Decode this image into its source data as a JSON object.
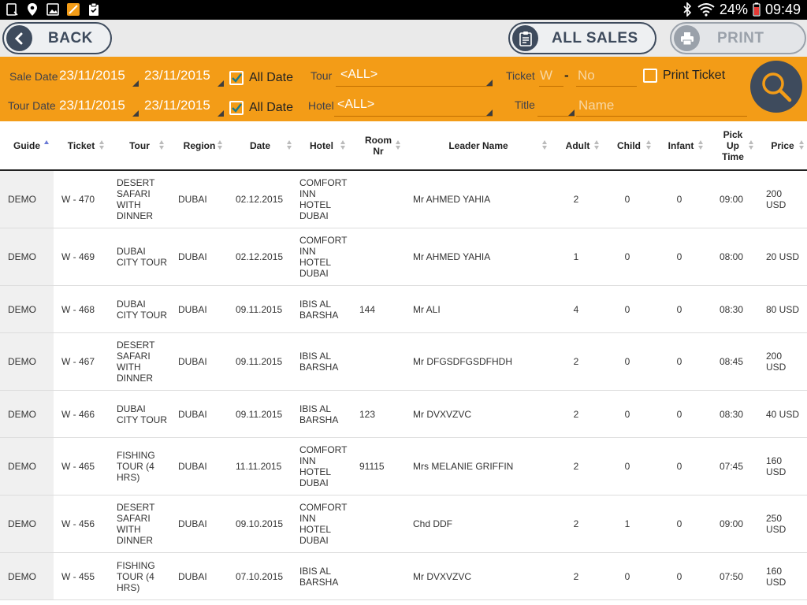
{
  "status_bar": {
    "battery": "24%",
    "time": "09:49"
  },
  "action_bar": {
    "back_label": "BACK",
    "all_sales_label": "ALL SALES",
    "print_label": "PRINT"
  },
  "filters": {
    "sale_date_label": "Sale Date",
    "sale_date_from": "23/11/2015",
    "sale_date_to": "23/11/2015",
    "tour_date_label": "Tour Date",
    "tour_date_from": "23/11/2015",
    "tour_date_to": "23/11/2015",
    "all_date_label": "All Date",
    "tour_label": "Tour",
    "tour_value": "<ALL>",
    "hotel_label": "Hotel",
    "hotel_value": "<ALL>",
    "ticket_label": "Ticket",
    "ticket_prefix": "W",
    "ticket_dash": "-",
    "ticket_no_placeholder": "No",
    "print_ticket_label": "Print Ticket",
    "title_label": "Title",
    "name_placeholder": "Name"
  },
  "table": {
    "columns": [
      "Guide",
      "Ticket",
      "Tour",
      "Region",
      "Date",
      "Hotel",
      "Room Nr",
      "Leader Name",
      "Adult",
      "Child",
      "Infant",
      "Pick Up Time",
      "Price"
    ],
    "rows": [
      {
        "guide": "DEMO",
        "ticket": "W - 470",
        "tour": "DESERT SAFARI WITH DINNER",
        "region": "DUBAI",
        "date": "02.12.2015",
        "hotel": "COMFORT INN HOTEL DUBAI",
        "room": "",
        "leader": "Mr AHMED YAHIA",
        "adult": "2",
        "child": "0",
        "infant": "0",
        "pickup": "09:00",
        "price": "200 USD"
      },
      {
        "guide": "DEMO",
        "ticket": "W - 469",
        "tour": "DUBAI CITY TOUR",
        "region": "DUBAI",
        "date": "02.12.2015",
        "hotel": "COMFORT INN HOTEL DUBAI",
        "room": "",
        "leader": "Mr AHMED YAHIA",
        "adult": "1",
        "child": "0",
        "infant": "0",
        "pickup": "08:00",
        "price": "20 USD"
      },
      {
        "guide": "DEMO",
        "ticket": "W - 468",
        "tour": "DUBAI CITY TOUR",
        "region": "DUBAI",
        "date": "09.11.2015",
        "hotel": "IBIS AL BARSHA",
        "room": "144",
        "leader": "Mr ALI",
        "adult": "4",
        "child": "0",
        "infant": "0",
        "pickup": "08:30",
        "price": "80 USD"
      },
      {
        "guide": "DEMO",
        "ticket": "W - 467",
        "tour": "DESERT SAFARI WITH DINNER",
        "region": "DUBAI",
        "date": "09.11.2015",
        "hotel": "IBIS AL BARSHA",
        "room": "",
        "leader": "Mr DFGSDFGSDFHDH",
        "adult": "2",
        "child": "0",
        "infant": "0",
        "pickup": "08:45",
        "price": "200 USD"
      },
      {
        "guide": "DEMO",
        "ticket": "W - 466",
        "tour": "DUBAI CITY TOUR",
        "region": "DUBAI",
        "date": "09.11.2015",
        "hotel": "IBIS AL BARSHA",
        "room": "123",
        "leader": "Mr DVXVZVC",
        "adult": "2",
        "child": "0",
        "infant": "0",
        "pickup": "08:30",
        "price": "40 USD"
      },
      {
        "guide": "DEMO",
        "ticket": "W - 465",
        "tour": "FISHING TOUR (4 HRS)",
        "region": "DUBAI",
        "date": "11.11.2015",
        "hotel": "COMFORT INN HOTEL DUBAI",
        "room": "91115",
        "leader": "Mrs MELANIE GRIFFIN",
        "adult": "2",
        "child": "0",
        "infant": "0",
        "pickup": "07:45",
        "price": "160 USD"
      },
      {
        "guide": "DEMO",
        "ticket": "W - 456",
        "tour": "DESERT SAFARI WITH DINNER",
        "region": "DUBAI",
        "date": "09.10.2015",
        "hotel": "COMFORT INN HOTEL DUBAI",
        "room": "",
        "leader": "Chd DDF",
        "adult": "2",
        "child": "1",
        "infant": "0",
        "pickup": "09:00",
        "price": "250 USD"
      },
      {
        "guide": "DEMO",
        "ticket": "W - 455",
        "tour": "FISHING TOUR (4 HRS)",
        "region": "DUBAI",
        "date": "07.10.2015",
        "hotel": "IBIS AL BARSHA",
        "room": "",
        "leader": "Mr DVXVZVC",
        "adult": "2",
        "child": "0",
        "infant": "0",
        "pickup": "07:50",
        "price": "160 USD"
      }
    ]
  },
  "colors": {
    "filter_bg": "#f39c17",
    "navy": "#3e4b5d"
  }
}
